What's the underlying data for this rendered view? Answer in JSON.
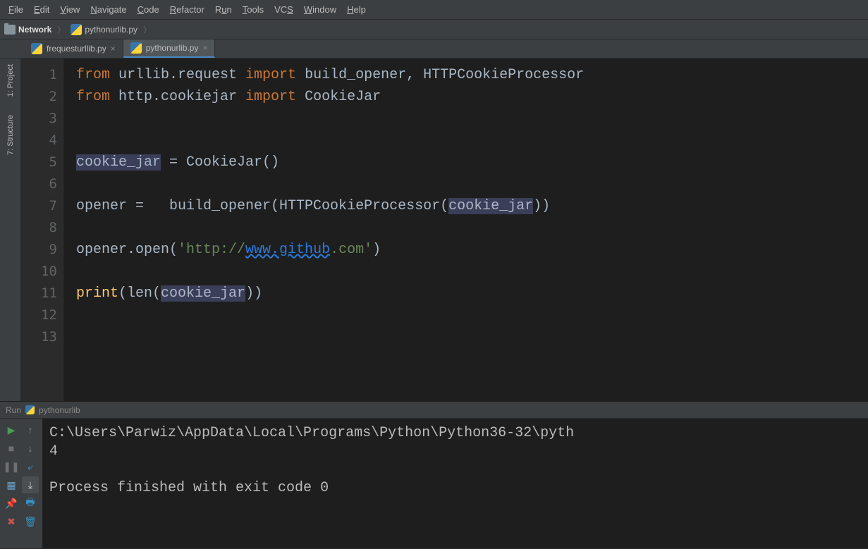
{
  "menu": [
    "File",
    "Edit",
    "View",
    "Navigate",
    "Code",
    "Refactor",
    "Run",
    "Tools",
    "VCS",
    "Window",
    "Help"
  ],
  "breadcrumb": {
    "root": "Network",
    "file": "pythonurlib.py"
  },
  "tabs": [
    {
      "label": "frequesturllib.py",
      "active": false
    },
    {
      "label": "pythonurlib.py",
      "active": true
    }
  ],
  "side": {
    "project": "1: Project",
    "structure": "7: Structure"
  },
  "code": {
    "l1a": "from",
    "l1b": " urllib.request ",
    "l1c": "import",
    "l1d": " build_opener, HTTPCookieProcessor",
    "l2a": "from",
    "l2b": " http.cookiejar ",
    "l2c": "import",
    "l2d": " CookieJar",
    "l5a": "cookie_jar",
    "l5b": " = CookieJar()",
    "l7a": "opener =   build_opener(HTTPCookieProcessor(",
    "l7b": "cookie_jar",
    "l7c": "))",
    "l9a": "opener.open(",
    "l9b": "'http://",
    "l9c": "www.github",
    "l9d": ".com'",
    "l9e": ")",
    "l11a": "print",
    "l11b": "(len(",
    "l11c": "cookie_jar",
    "l11d": "))"
  },
  "lines": [
    "1",
    "2",
    "3",
    "4",
    "5",
    "6",
    "7",
    "8",
    "9",
    "10",
    "11",
    "12",
    "13"
  ],
  "run": {
    "title": "Run",
    "name": "pythonurlib",
    "out1": "C:\\Users\\Parwiz\\AppData\\Local\\Programs\\Python\\Python36-32\\pyth",
    "out2": "4",
    "out3": "Process finished with exit code 0"
  }
}
